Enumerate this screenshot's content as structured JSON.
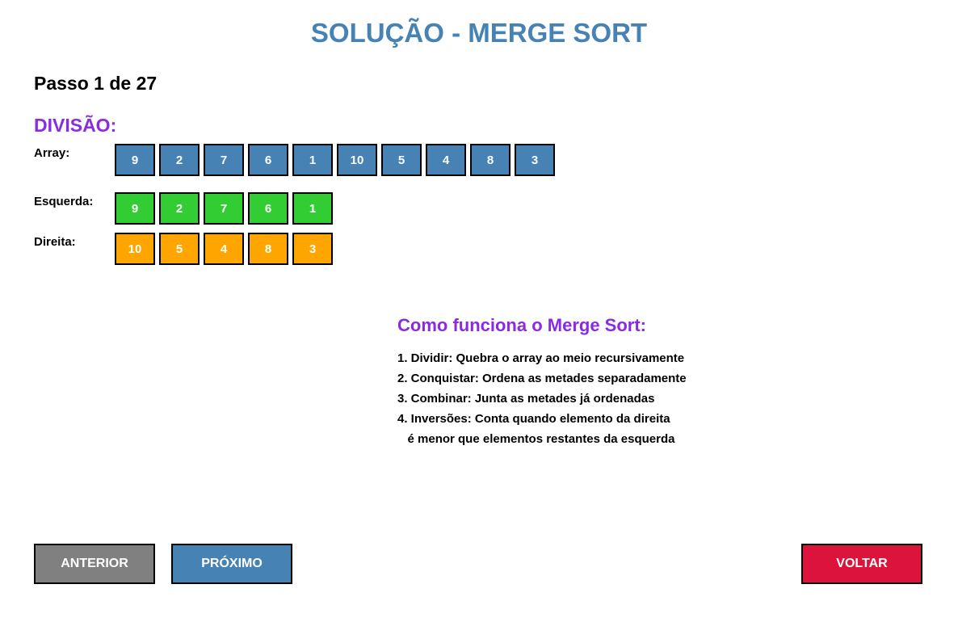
{
  "title": "SOLUÇÃO - MERGE SORT",
  "step_text": "Passo 1 de 27",
  "division": {
    "heading": "DIVISÃO:",
    "array_label": "Array:",
    "array": [
      "9",
      "2",
      "7",
      "6",
      "1",
      "10",
      "5",
      "4",
      "8",
      "3"
    ],
    "left_label": "Esquerda:",
    "left": [
      "9",
      "2",
      "7",
      "6",
      "1"
    ],
    "right_label": "Direita:",
    "right": [
      "10",
      "5",
      "4",
      "8",
      "3"
    ]
  },
  "colors": {
    "title": "#4682b4",
    "heading": "#8a2be2",
    "array_cell": "#4682b4",
    "left_cell": "#32cd32",
    "right_cell": "#ffa500",
    "prev_button": "#808080",
    "next_button": "#4682b4",
    "back_button": "#dc143c"
  },
  "info": {
    "heading": "Como funciona o Merge Sort:",
    "lines": [
      "1. Dividir: Quebra o array ao meio recursivamente",
      "2. Conquistar: Ordena as metades separadamente",
      "3. Combinar: Junta as metades já ordenadas",
      "4. Inversões: Conta quando elemento da direita",
      "   é menor que elementos restantes da esquerda"
    ]
  },
  "buttons": {
    "prev": "ANTERIOR",
    "next": "PRÓXIMO",
    "back": "VOLTAR"
  }
}
